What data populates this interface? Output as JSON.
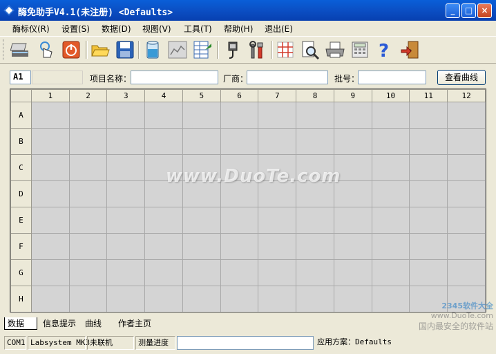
{
  "window": {
    "title": "酶免助手V4.1(未注册) <Defaults>"
  },
  "title_buttons": {
    "minimize": "_",
    "maximize": "□",
    "close": "×"
  },
  "menu": [
    "酶标仪(R)",
    "设置(S)",
    "数据(D)",
    "视图(V)",
    "工具(T)",
    "帮助(H)",
    "退出(E)"
  ],
  "toolbar": {
    "icons": [
      "scanner-icon",
      "hand-pointer-icon",
      "power-icon",
      "open-folder-icon",
      "save-disk-icon",
      "beaker-icon",
      "line-chart-icon",
      "spreadsheet-icon",
      "plug-icon",
      "tools-icon",
      "grid-icon",
      "preview-icon",
      "printer-icon",
      "calculator-icon",
      "help-icon",
      "exit-door-icon"
    ]
  },
  "infobar": {
    "well_id": "A1",
    "well_value": "",
    "project_label": "项目名称：",
    "project_value": "",
    "vendor_label": "厂商：",
    "vendor_value": "",
    "batch_label": "批号：",
    "batch_value": "",
    "view_curve_button": "查看曲线"
  },
  "plate": {
    "columns": [
      "1",
      "2",
      "3",
      "4",
      "5",
      "6",
      "7",
      "8",
      "9",
      "10",
      "11",
      "12"
    ],
    "rows": [
      "A",
      "B",
      "C",
      "D",
      "E",
      "F",
      "G",
      "H"
    ]
  },
  "watermark": "www.DuoTe.com",
  "tabs": [
    "数据",
    "信息提示",
    "曲线",
    "作者主页"
  ],
  "active_tab": 0,
  "status": {
    "port": "COM1",
    "device": "Labsystem MK3",
    "connection": "未联机",
    "progress_label": "测量进度",
    "progress_value": 0,
    "scheme": "应用方案：Defaults"
  },
  "corner_logo": {
    "line1": "2345软件大全",
    "line2": "www.DuoTe.com",
    "line3": "国内最安全的软件站"
  }
}
